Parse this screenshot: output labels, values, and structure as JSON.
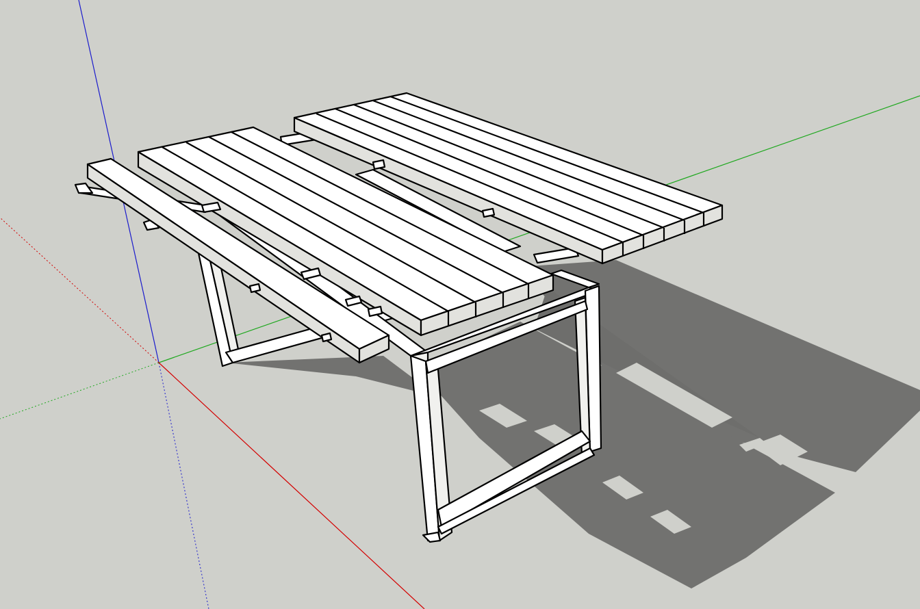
{
  "viewport": {
    "background_color": "#cfd0cb",
    "shadow_color": "#727270",
    "face_color": "#ffffff",
    "edge_color": "#000000"
  },
  "axes": {
    "red": "#d40000",
    "green": "#1fa81f",
    "blue": "#1a1acc"
  }
}
